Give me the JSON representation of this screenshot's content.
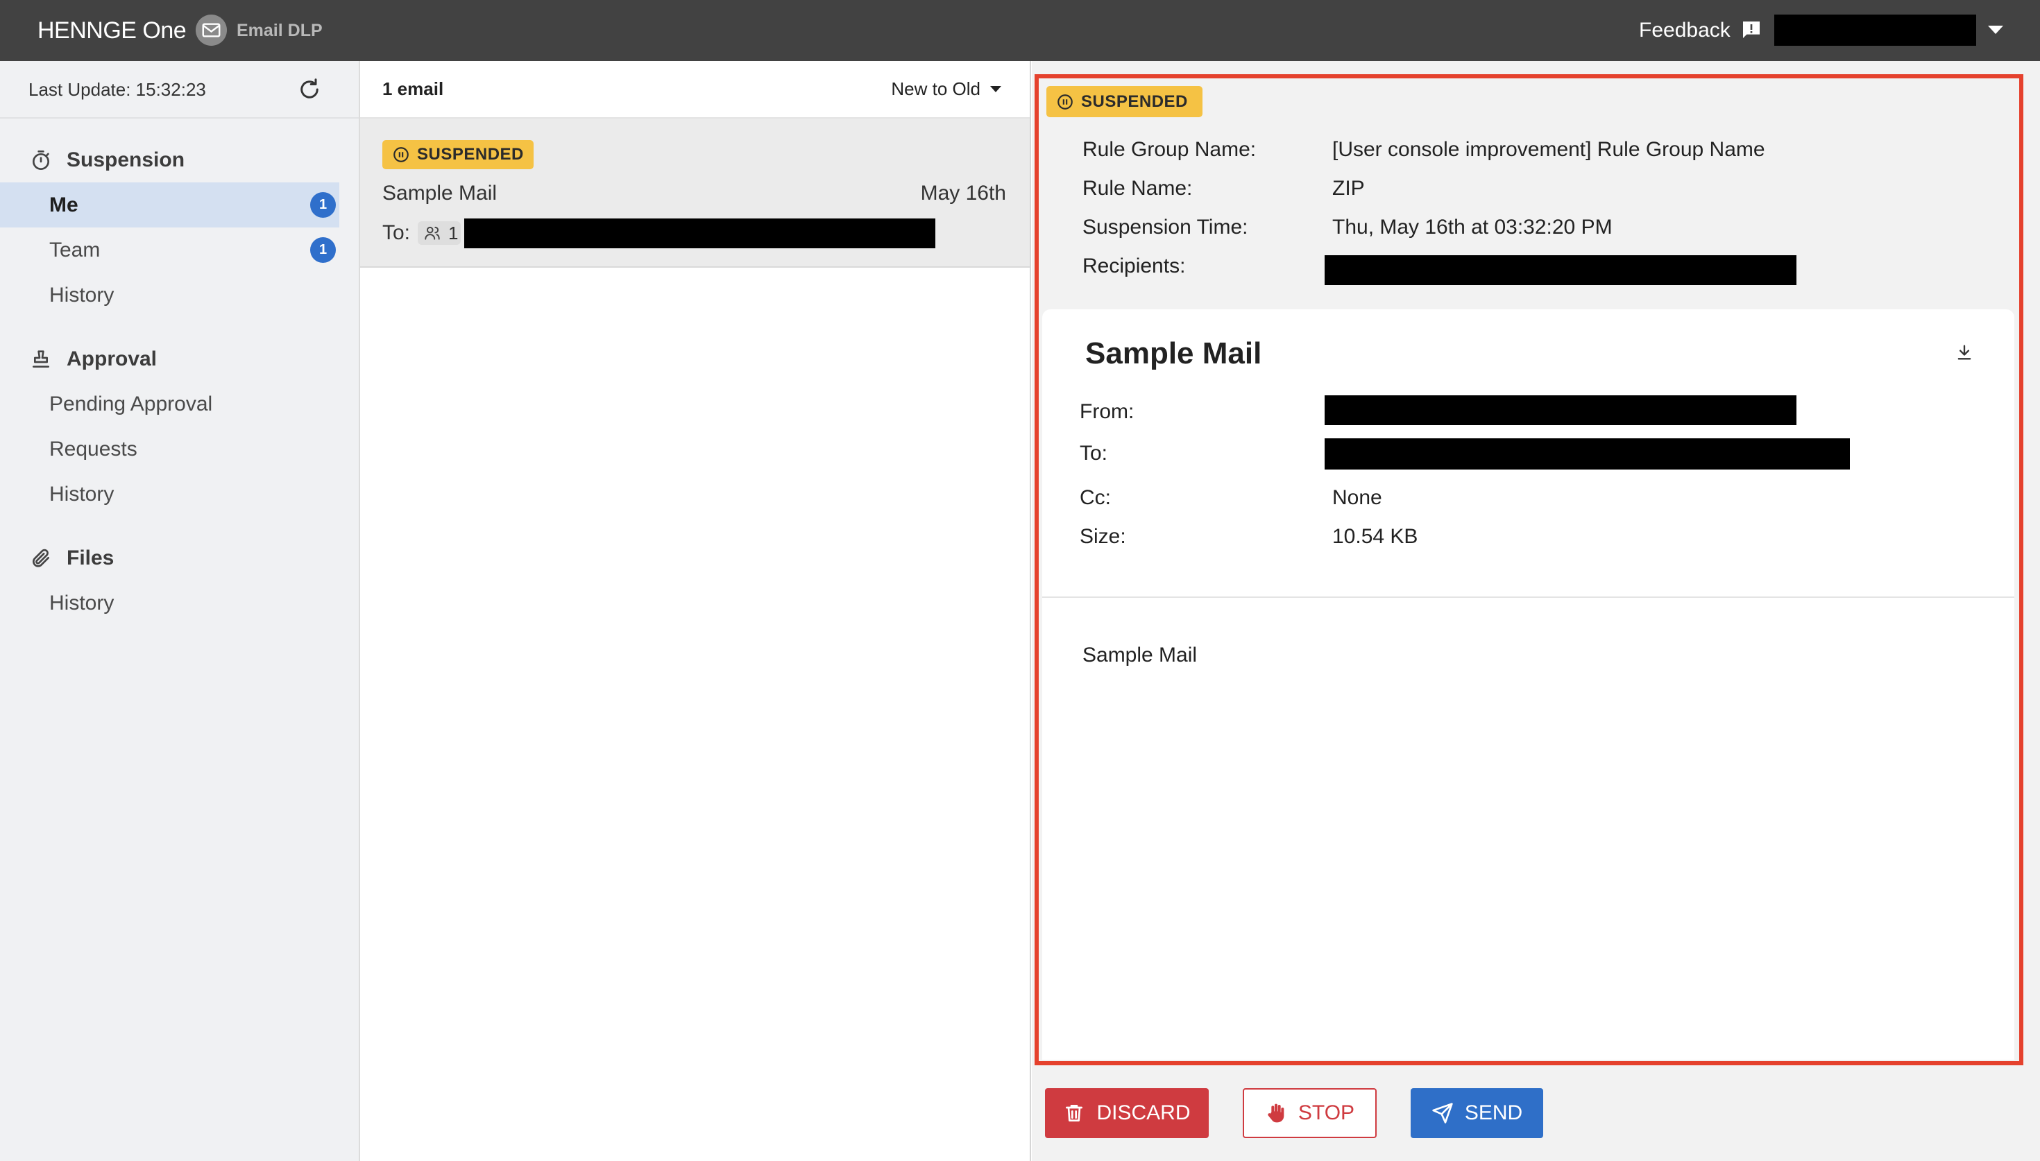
{
  "topbar": {
    "brand": "HENNGE One",
    "brand_icon": "mail-icon",
    "product": "Email DLP",
    "feedback_label": "Feedback",
    "feedback_icon": "feedback-icon",
    "account_menu_icon": "caret-down-icon"
  },
  "sidebar": {
    "last_update": "Last Update: 15:32:23",
    "refresh_icon": "refresh-icon",
    "sections": [
      {
        "title": "Suspension",
        "icon": "timer-icon",
        "items": [
          {
            "label": "Me",
            "badge": "1",
            "selected": true
          },
          {
            "label": "Team",
            "badge": "1"
          },
          {
            "label": "History"
          }
        ]
      },
      {
        "title": "Approval",
        "icon": "stamp-icon",
        "items": [
          {
            "label": "Pending Approval"
          },
          {
            "label": "Requests"
          },
          {
            "label": "History"
          }
        ]
      },
      {
        "title": "Files",
        "icon": "paperclip-icon",
        "items": [
          {
            "label": "History"
          }
        ]
      }
    ]
  },
  "email_list": {
    "count_label": "1 email",
    "sort_label": "New to Old",
    "emails": [
      {
        "status": "SUSPENDED",
        "status_icon": "pause-circle-icon",
        "subject": "Sample Mail",
        "date": "May 16th",
        "to_label": "To:",
        "recipient_icon": "people-icon",
        "recipient_count": "1",
        "recipients_redacted": true,
        "selected": true
      }
    ]
  },
  "detail": {
    "status": "SUSPENDED",
    "rule_info": [
      {
        "label": "Rule Group Name:",
        "value": "[User console improvement] Rule Group Name"
      },
      {
        "label": "Rule Name:",
        "value": "ZIP"
      },
      {
        "label": "Suspension Time:",
        "value": "Thu, May 16th at 03:32:20 PM"
      },
      {
        "label": "Recipients:",
        "redacted": true
      }
    ],
    "message": {
      "subject": "Sample Mail",
      "download_icon": "download-icon",
      "fields": [
        {
          "label": "From:",
          "redacted": true
        },
        {
          "label": "To:",
          "redacted": true
        },
        {
          "label": "Cc:",
          "value": "None"
        },
        {
          "label": "Size:",
          "value": "10.54 KB"
        }
      ],
      "body": "Sample Mail"
    }
  },
  "actions": {
    "discard": "DISCARD",
    "discard_icon": "trash-icon",
    "stop": "STOP",
    "stop_icon": "hand-icon",
    "send": "SEND",
    "send_icon": "paper-plane-icon"
  },
  "colors": {
    "topbar": "#424242",
    "sidebar_bg": "#f0f1f3",
    "selected_bg": "#d4e0f1",
    "count_badge": "#2f6fcb",
    "suspended": "#f5c244",
    "item_bg": "#ebebeb",
    "detail_bg": "#f2f2f2",
    "highlight": "#e5412d",
    "discard": "#cf3b40",
    "send": "#2f6fc8"
  }
}
